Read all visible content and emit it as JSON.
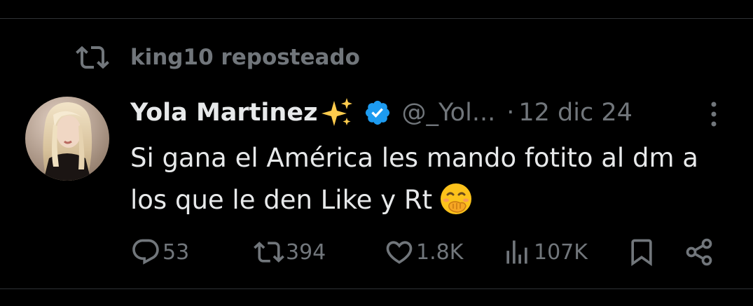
{
  "repost": {
    "icon": "repost-icon",
    "text": "king10 reposteado"
  },
  "tweet": {
    "display_name": "Yola Martinez",
    "name_emoji": "sparkles-icon",
    "verified_icon": "verified-badge-icon",
    "handle": "@_Yol...",
    "separator": "·",
    "date": "12 dic 24",
    "text": "Si gana el América les mando fotito al dm a los que le den Like y Rt",
    "text_emoji": "hand-over-mouth-emoji"
  },
  "actions": {
    "replies": "53",
    "reposts": "394",
    "likes": "1.8K",
    "views": "107K"
  },
  "colors": {
    "background": "#000000",
    "text": "#e7e9ea",
    "muted": "#71767b",
    "verified": "#1d9bf0",
    "divider": "#2f3336"
  }
}
